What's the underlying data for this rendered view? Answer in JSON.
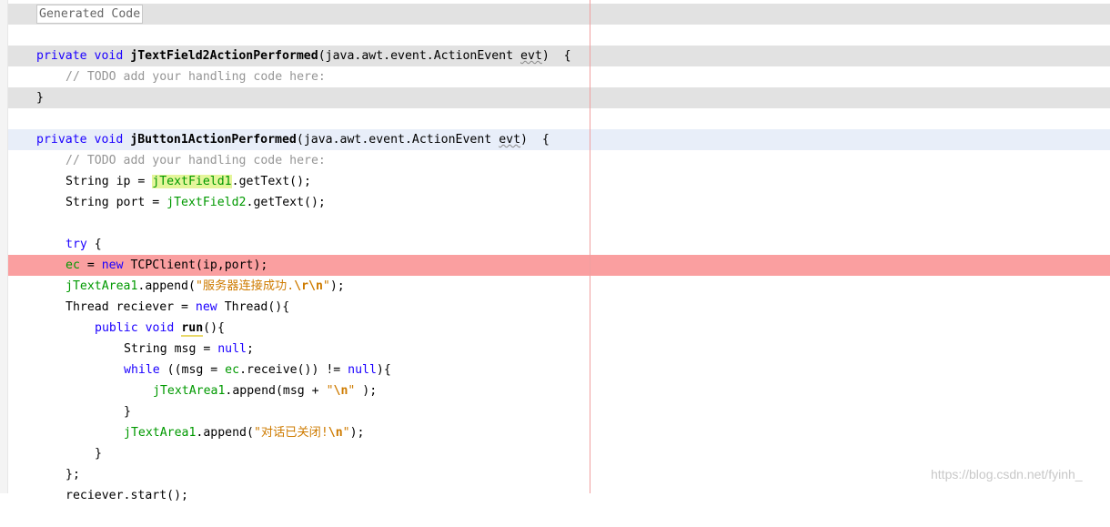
{
  "editor": {
    "fold_label": "Generated Code",
    "lines": {
      "m1_private": "private",
      "m1_void": "void",
      "m1_name": "jTextField2ActionPerformed",
      "m1_params_a": "(java.awt.event.ActionEvent ",
      "m1_params_evt": "evt",
      "m1_params_b": ")  {",
      "m1_todo": "// TODO add your handling code here:",
      "m1_close": "}",
      "m2_private": "private",
      "m2_void": "void",
      "m2_name": "jButton1ActionPerformed",
      "m2_params_a": "(java.awt.event.ActionEvent ",
      "m2_params_evt": "evt",
      "m2_params_b": ")  {",
      "m2_todo": "// TODO add your handling code here:",
      "ip_a": "String ip = ",
      "ip_field": "jTextField1",
      "ip_b": ".getText();",
      "port_a": "String port = ",
      "port_field": "jTextField2",
      "port_b": ".getText();",
      "try_kw": "try",
      "try_b": " {",
      "ec_field": "ec",
      "ec_a": " = ",
      "ec_new": "new",
      "ec_b": " TCPClient(ip,port);",
      "app1_field": "jTextArea1",
      "app1_a": ".append(",
      "app1_str": "\"服务器连接成功.",
      "app1_esc": "\\r\\n",
      "app1_q": "\"",
      "app1_b": ");",
      "thr_a": "Thread reciever = ",
      "thr_new": "new",
      "thr_b": " Thread(){",
      "run_public": "public",
      "run_void": "void",
      "run_name": "run",
      "run_b": "(){",
      "msg_a": "String msg = ",
      "msg_null": "null",
      "msg_b": ";",
      "while_kw": "while",
      "while_a": " ((msg = ",
      "while_ec": "ec",
      "while_b": ".receive()) != ",
      "while_null": "null",
      "while_c": "){",
      "app2_field": "jTextArea1",
      "app2_a": ".append(msg + ",
      "app2_q1": "\"",
      "app2_esc": "\\n",
      "app2_q2": "\"",
      "app2_b": " );",
      "close_while": "}",
      "app3_field": "jTextArea1",
      "app3_a": ".append(",
      "app3_str": "\"对话已关闭!",
      "app3_esc": "\\n",
      "app3_q": "\"",
      "app3_b": ");",
      "close_run": "}",
      "close_thread": "};",
      "partial": "reciever.start();"
    }
  },
  "watermark": "https://blog.csdn.net/fyinh_",
  "colors": {
    "keyword": "#1b00ff",
    "field": "#009900",
    "string": "#ce7b00",
    "comment": "#969696",
    "breakpoint_line": "#fa9fa0",
    "guarded_block": "#e2e2e2",
    "current_line": "#e8eef9",
    "occurrence_highlight": "#e4f59a"
  }
}
